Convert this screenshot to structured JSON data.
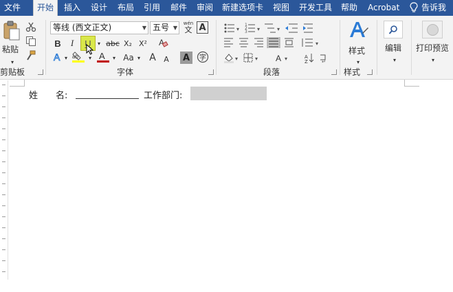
{
  "tabs": {
    "file": "文件",
    "home": "开始",
    "insert": "插入",
    "design": "设计",
    "layout": "布局",
    "references": "引用",
    "mailings": "邮件",
    "review": "审阅",
    "new_tab": "新建选项卡",
    "view": "视图",
    "developer": "开发工具",
    "help": "帮助",
    "acrobat": "Acrobat",
    "tell_me": "告诉我"
  },
  "clipboard": {
    "paste_label": "粘贴",
    "group_label": "剪贴板"
  },
  "font": {
    "font_name": "等线 (西文正文)",
    "font_size": "五号",
    "bold": "B",
    "italic": "I",
    "underline": "U",
    "strikethrough": "abc",
    "subscript": "X₂",
    "superscript": "X²",
    "change_case": "Aa",
    "grow_font": "A",
    "shrink_font": "A",
    "char_shading": "A",
    "enclose_char": "字",
    "phonetic_top": "wén",
    "phonetic_char": "文",
    "group_label": "字体"
  },
  "paragraph": {
    "group_label": "段落"
  },
  "styles": {
    "button_label": "样式",
    "group_label": "样式"
  },
  "editing": {
    "button_label": "编辑"
  },
  "print_preview": {
    "button_label": "打印预览"
  },
  "document": {
    "name_label": "姓　　名:",
    "department_label": "工作部门:"
  },
  "colors": {
    "accent": "#2b579a",
    "highlight": "#ffff00",
    "font_color": "#c00000"
  }
}
